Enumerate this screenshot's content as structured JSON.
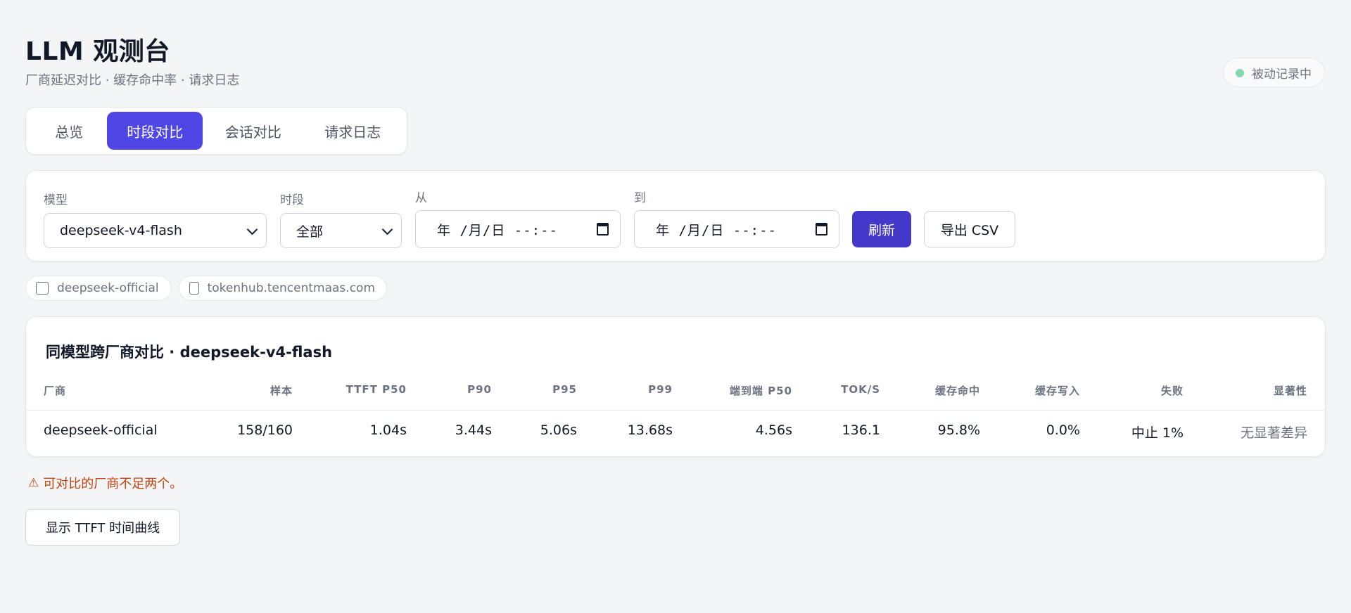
{
  "header": {
    "title": "LLM 观测台",
    "subtitle": "厂商延迟对比 · 缓存命中率 · 请求日志"
  },
  "status": {
    "label": "被动记录中",
    "dot_color": "#86d6b0"
  },
  "tabs": [
    {
      "label": "总览",
      "active": false
    },
    {
      "label": "时段对比",
      "active": true
    },
    {
      "label": "会话对比",
      "active": false
    },
    {
      "label": "请求日志",
      "active": false
    }
  ],
  "filters": {
    "model_label": "模型",
    "model_value": "deepseek-v4-flash",
    "period_label": "时段",
    "period_value": "全部",
    "from_label": "从",
    "from_value": "年 /月/日 --:--",
    "to_label": "到",
    "to_value": "年 /月/日 --:--",
    "refresh_label": "刷新",
    "export_label": "导出 CSV"
  },
  "vendors": [
    {
      "label": "deepseek-official",
      "checked": false
    },
    {
      "label": "tokenhub.tencentmaas.com",
      "checked": false
    }
  ],
  "table": {
    "title": "同模型跨厂商对比 · deepseek-v4-flash",
    "columns": [
      "厂商",
      "样本",
      "TTFT P50",
      "P90",
      "P95",
      "P99",
      "端到端 P50",
      "TOK/S",
      "缓存命中",
      "缓存写入",
      "失败",
      "显著性"
    ],
    "rows": [
      [
        "deepseek-official",
        "158/160",
        "1.04s",
        "3.44s",
        "5.06s",
        "13.68s",
        "4.56s",
        "136.1",
        "95.8%",
        "0.0%",
        "中止 1%",
        "无显著差异"
      ]
    ]
  },
  "warning": {
    "icon": "⚠",
    "text": "可对比的厂商不足两个。"
  },
  "curve_button": {
    "label": "显示 TTFT 时间曲线"
  },
  "colors": {
    "accent": "#4f46e5",
    "primary_button": "#4338ca",
    "warning": "#c2410c"
  }
}
